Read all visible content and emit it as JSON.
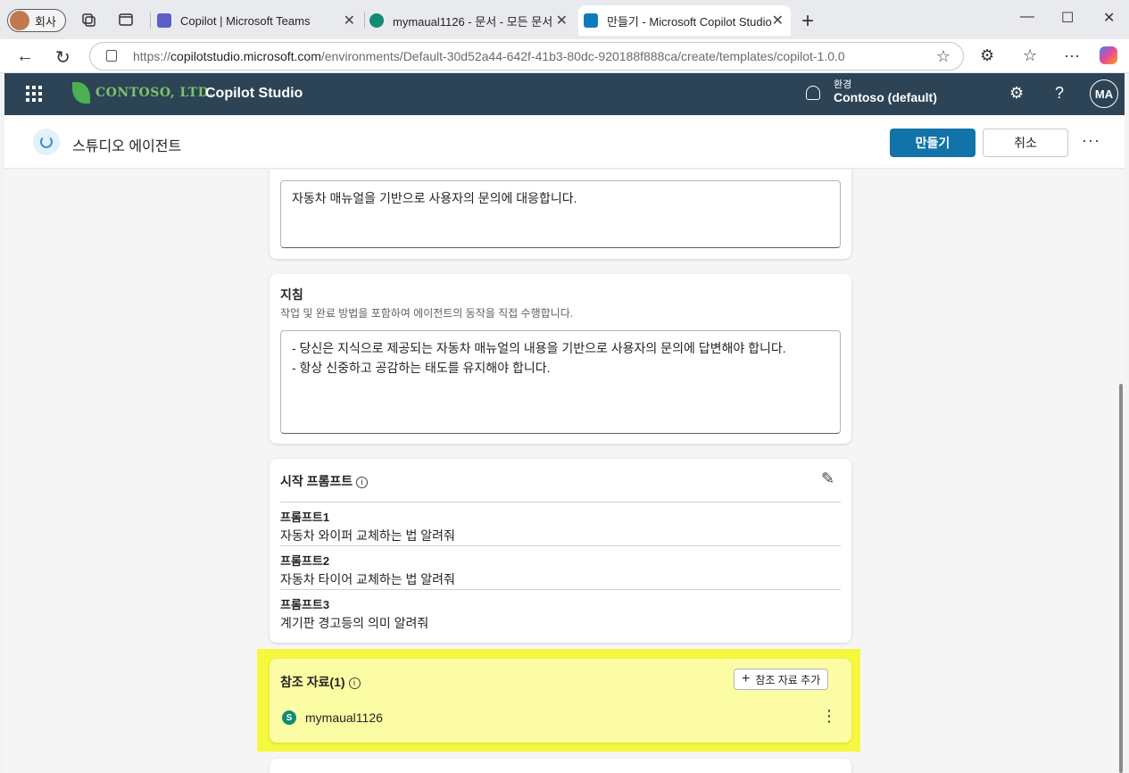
{
  "browser": {
    "profile_label": "회사",
    "tabs": [
      {
        "title": "Copilot | Microsoft Teams",
        "color": "#5b5fc7"
      },
      {
        "title": "mymaual1126 - 문서 - 모든 문서",
        "color": "#138a71"
      },
      {
        "title": "만들기 - Microsoft Copilot Studio",
        "color": "#0e7bbd",
        "active": true
      }
    ],
    "url_prefix": "https://",
    "url_host": "copilotstudio.microsoft.com",
    "url_path": "/environments/Default-30d52a44-642f-41b3-80dc-920188f888ca/create/templates/copilot-1.0.0"
  },
  "app": {
    "brand": "CONTOSO, LTD.",
    "title": "Copilot Studio",
    "env_label": "환경",
    "env_value": "Contoso (default)",
    "user_initials": "MA"
  },
  "subheader": {
    "title": "스튜디오 에이전트",
    "create_label": "만들기",
    "cancel_label": "취소"
  },
  "description": {
    "value": "자동차 매뉴얼을 기반으로 사용자의 문의에 대응합니다."
  },
  "instructions": {
    "title": "지침",
    "desc": "작업 및 완료 방법을 포함하여 에이전트의 동작을 직접 수행합니다.",
    "value": "- 당신은 지식으로 제공되는 자동차 매뉴얼의 내용을 기반으로 사용자의 문의에 답변해야 합니다.\n- 항상 신중하고 공감하는 태도를 유지해야 합니다."
  },
  "starter_prompts": {
    "title": "시작 프롬프트",
    "items": [
      {
        "title": "프롬프트1",
        "value": "자동차 와이퍼 교체하는 법 알려줘"
      },
      {
        "title": "프롬프트2",
        "value": "자동차 타이어 교체하는 법 알려줘"
      },
      {
        "title": "프롬프트3",
        "value": "계기판 경고등의 의미 알려줘"
      }
    ]
  },
  "knowledge": {
    "title": "참조 자료(1)",
    "add_label": "참조 자료 추가",
    "files": [
      {
        "name": "mymaual1126"
      }
    ]
  }
}
